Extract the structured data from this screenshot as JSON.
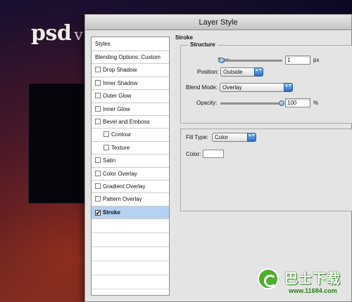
{
  "background": {
    "logo": "psd",
    "logo_suffix": "v"
  },
  "dialog": {
    "title": "Layer Style"
  },
  "styles_list": {
    "header": "Styles",
    "items": [
      {
        "label": "Blending Options: Custom",
        "checkbox": false,
        "checked": false,
        "indent": false,
        "selected": false
      },
      {
        "label": "Drop Shadow",
        "checkbox": true,
        "checked": false,
        "indent": false,
        "selected": false
      },
      {
        "label": "Inner Shadow",
        "checkbox": true,
        "checked": false,
        "indent": false,
        "selected": false
      },
      {
        "label": "Outer Glow",
        "checkbox": true,
        "checked": false,
        "indent": false,
        "selected": false
      },
      {
        "label": "Inner Glow",
        "checkbox": true,
        "checked": false,
        "indent": false,
        "selected": false
      },
      {
        "label": "Bevel and Emboss",
        "checkbox": true,
        "checked": false,
        "indent": false,
        "selected": false
      },
      {
        "label": "Contour",
        "checkbox": true,
        "checked": false,
        "indent": true,
        "selected": false
      },
      {
        "label": "Texture",
        "checkbox": true,
        "checked": false,
        "indent": true,
        "selected": false
      },
      {
        "label": "Satin",
        "checkbox": true,
        "checked": false,
        "indent": false,
        "selected": false
      },
      {
        "label": "Color Overlay",
        "checkbox": true,
        "checked": false,
        "indent": false,
        "selected": false
      },
      {
        "label": "Gradient Overlay",
        "checkbox": true,
        "checked": false,
        "indent": false,
        "selected": false
      },
      {
        "label": "Pattern Overlay",
        "checkbox": true,
        "checked": false,
        "indent": false,
        "selected": false
      },
      {
        "label": "Stroke",
        "checkbox": true,
        "checked": true,
        "indent": false,
        "selected": true
      }
    ]
  },
  "stroke": {
    "title": "Stroke",
    "structure_title": "Structure",
    "size_label": "Size:",
    "size_value": "1",
    "size_unit": "px",
    "position_label": "Position:",
    "position_value": "Outside",
    "blend_mode_label": "Blend Mode:",
    "blend_mode_value": "Overlay",
    "opacity_label": "Opacity:",
    "opacity_value": "100",
    "opacity_unit": "%",
    "fill_type_label": "Fill Type:",
    "fill_type_value": "Color",
    "color_label": "Color:",
    "color_value": "#ffffff"
  },
  "watermark": {
    "text": "巴士下载",
    "url": "www.11684.com",
    "color": "#4fae2e"
  },
  "colors": {
    "selected_row": "#b5d2f2",
    "dialog_bg": "#e4e4e4",
    "select_accent": "#2a6fc6"
  },
  "icons": {
    "check": "✔",
    "select_arrows": "▲▼"
  }
}
